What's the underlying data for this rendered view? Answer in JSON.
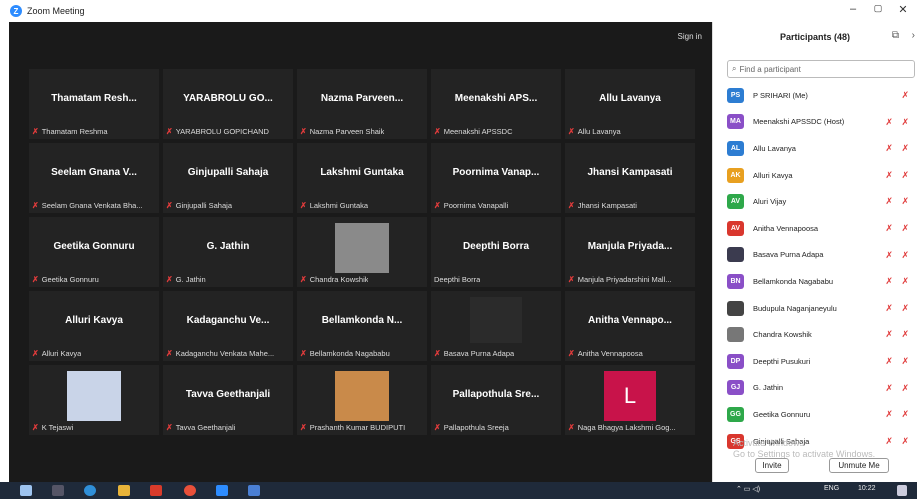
{
  "window": {
    "title": "Zoom Meeting",
    "min": "–",
    "max": "▢",
    "close": "✕"
  },
  "video": {
    "sign_in": "Sign in"
  },
  "tiles": [
    {
      "name": "Thamatam Resh...",
      "label": "Thamatam Reshma",
      "muted": true
    },
    {
      "name": "YARABROLU GO...",
      "label": "YARABROLU GOPICHAND",
      "muted": true
    },
    {
      "name": "Nazma Parveen...",
      "label": "Nazma Parveen Shaik",
      "muted": true
    },
    {
      "name": "Meenakshi APS...",
      "label": "Meenakshi APSSDC",
      "muted": true
    },
    {
      "name": "Allu Lavanya",
      "label": "Allu Lavanya",
      "muted": true
    },
    {
      "name": "Seelam Gnana V...",
      "label": "Seelam Gnana Venkata Bha...",
      "muted": true
    },
    {
      "name": "Ginjupalli Sahaja",
      "label": "Ginjupalli Sahaja",
      "muted": true
    },
    {
      "name": "Lakshmi Guntaka",
      "label": "Lakshmi Guntaka",
      "muted": true
    },
    {
      "name": "Poornima Vanap...",
      "label": "Poornima Vanapalli",
      "muted": true
    },
    {
      "name": "Jhansi Kampasati",
      "label": "Jhansi Kampasati",
      "muted": true
    },
    {
      "name": "Geetika Gonnuru",
      "label": "Geetika Gonnuru",
      "muted": true
    },
    {
      "name": "G. Jathin",
      "label": "G. Jathin",
      "muted": true
    },
    {
      "name": "",
      "label": "Chandra Kowshik",
      "muted": true,
      "photo": "person"
    },
    {
      "name": "Deepthi Borra",
      "label": "Deepthi Borra",
      "muted": false
    },
    {
      "name": "Manjula Priyada...",
      "label": "Manjula Priyadarshini Mall...",
      "muted": true
    },
    {
      "name": "Alluri Kavya",
      "label": "Alluri Kavya",
      "muted": true
    },
    {
      "name": "Kadaganchu Ve...",
      "label": "Kadaganchu Venkata Mahe...",
      "muted": true
    },
    {
      "name": "Bellamkonda N...",
      "label": "Bellamkonda Nagababu",
      "muted": true
    },
    {
      "name": "",
      "label": "Basava Purna Adapa",
      "muted": true,
      "photo": "figure"
    },
    {
      "name": "Anitha Vennapo...",
      "label": "Anitha Vennapoosa",
      "muted": true
    },
    {
      "name": "",
      "label": "K Tejaswi",
      "muted": true,
      "photo": "note"
    },
    {
      "name": "Tavva Geethanjali",
      "label": "Tavva Geethanjali",
      "muted": true
    },
    {
      "name": "",
      "label": "Prashanth Kumar BUDIPUTI",
      "muted": true,
      "photo": "art"
    },
    {
      "name": "Pallapothula Sre...",
      "label": "Pallapothula Sreeja",
      "muted": true
    },
    {
      "name": "",
      "label": "Naga Bhagya Lakshmi Gog...",
      "muted": true,
      "photo": "letter",
      "letter": "L"
    }
  ],
  "panel": {
    "title": "Participants (48)",
    "search_placeholder": "Find a participant",
    "invite": "Invite",
    "unmute_me": "Unmute Me",
    "watermark_1": "Activate Windows",
    "watermark_2": "Go to Settings to activate Windows.",
    "participants": [
      {
        "initials": "PS",
        "name": "P SRIHARI (Me)",
        "color": "#2d7dd2"
      },
      {
        "initials": "MA",
        "name": "Meenakshi APSSDC (Host)",
        "color": "#8a4fc7"
      },
      {
        "initials": "AL",
        "name": "Allu Lavanya",
        "color": "#2d7dd2"
      },
      {
        "initials": "AK",
        "name": "Alluri Kavya",
        "color": "#e8a020"
      },
      {
        "initials": "AV",
        "name": "Aluri Vijay",
        "color": "#2ea84a"
      },
      {
        "initials": "AV",
        "name": "Anitha Vennapoosa",
        "color": "#d9372e"
      },
      {
        "initials": "",
        "name": "Basava Purna Adapa",
        "color": "#3b3b4f"
      },
      {
        "initials": "BN",
        "name": "Bellamkonda Nagababu",
        "color": "#8a4fc7"
      },
      {
        "initials": "",
        "name": "Budupula Naganjaneyulu",
        "color": "#444"
      },
      {
        "initials": "",
        "name": "Chandra Kowshik",
        "color": "#777"
      },
      {
        "initials": "DP",
        "name": "Deepthi Pusukuri",
        "color": "#8a4fc7"
      },
      {
        "initials": "GJ",
        "name": "G. Jathin",
        "color": "#8a4fc7"
      },
      {
        "initials": "GG",
        "name": "Geetika Gonnuru",
        "color": "#2ea84a"
      },
      {
        "initials": "GS",
        "name": "Ginjupalli Sahaja",
        "color": "#d9372e"
      }
    ]
  },
  "taskbar": {
    "lang": "ENG",
    "time": "10:22"
  }
}
